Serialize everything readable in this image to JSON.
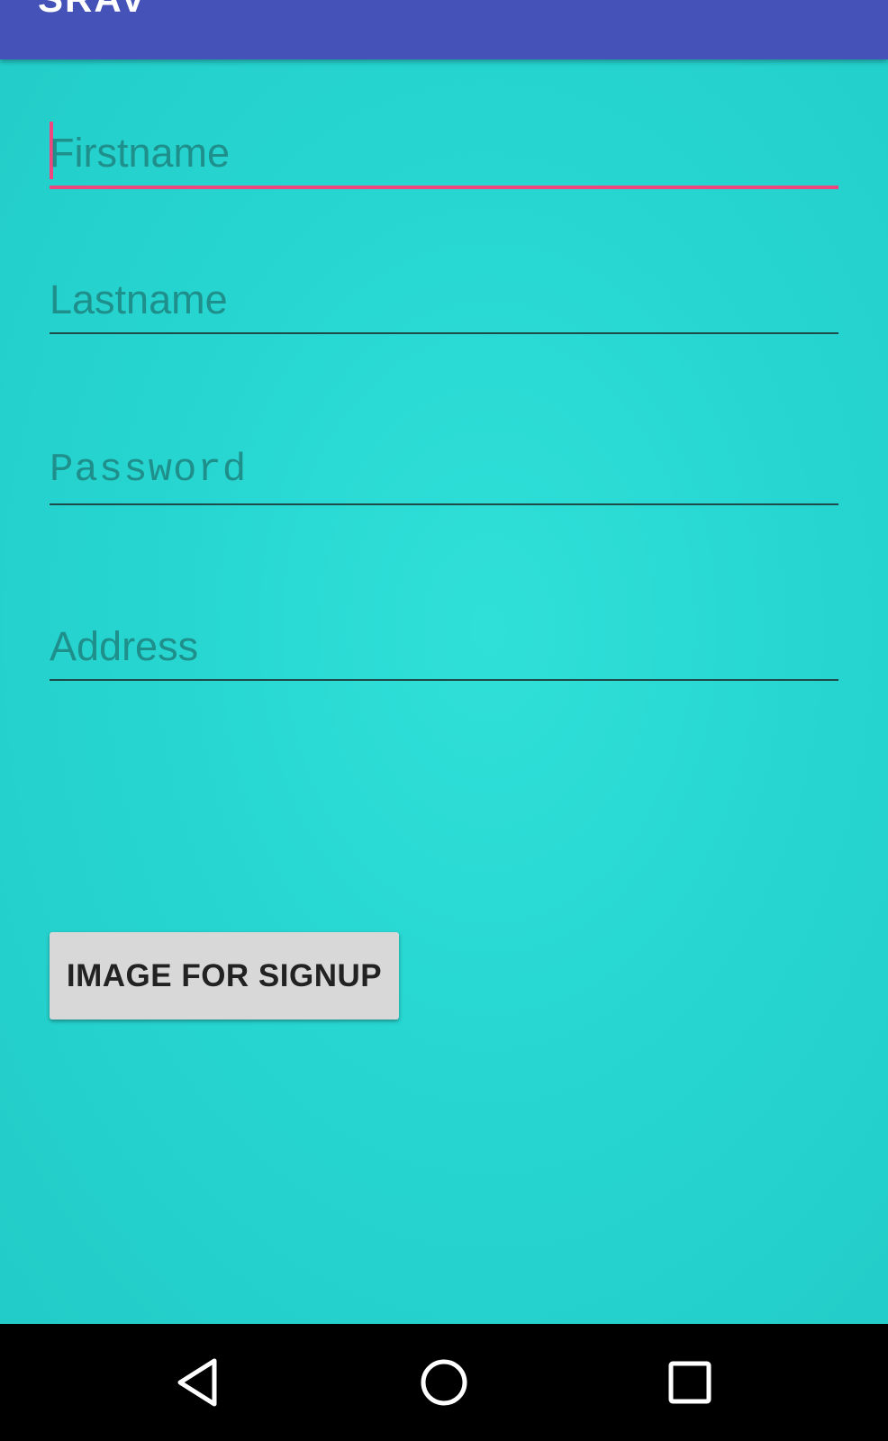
{
  "app_bar": {
    "title": "SRAV",
    "color": "#4552b8"
  },
  "form": {
    "background_color": "#27d6d1",
    "fields": [
      {
        "name": "firstname",
        "placeholder": "Firstname",
        "focused": true
      },
      {
        "name": "lastname",
        "placeholder": "Lastname",
        "focused": false
      },
      {
        "name": "password",
        "placeholder": "Password",
        "focused": false
      },
      {
        "name": "address",
        "placeholder": "Address",
        "focused": false
      }
    ],
    "accent_color": "#f0457e",
    "signup_button_label": "IMAGE FOR SIGNUP"
  },
  "nav_bar": {
    "buttons": [
      {
        "icon": "back-triangle-icon"
      },
      {
        "icon": "home-circle-icon"
      },
      {
        "icon": "recents-square-icon"
      }
    ]
  }
}
